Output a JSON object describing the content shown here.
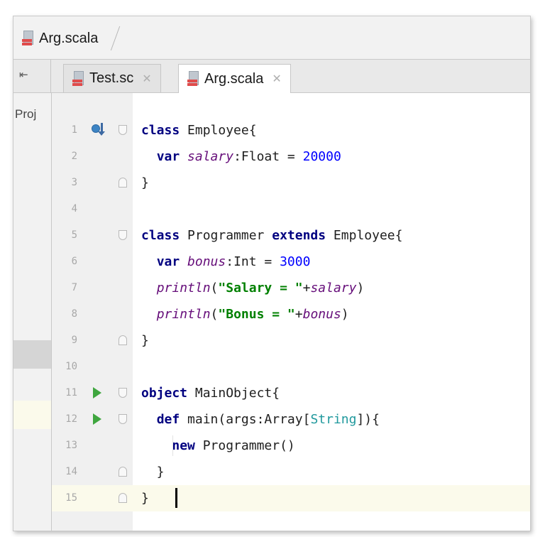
{
  "breadcrumb": {
    "file": "Arg.scala"
  },
  "tabs": [
    {
      "label": "Test.sc",
      "active": false
    },
    {
      "label": "Arg.scala",
      "active": true
    }
  ],
  "project_pane": {
    "label": "Proj"
  },
  "icons": {
    "collapse_panel": "collapse-panel-icon",
    "scala_file": "scala-file-icon",
    "run_gutter": "run-gutter-icon",
    "override_gutter": "override-gutter-icon"
  },
  "colors": {
    "keyword": "#000080",
    "field": "#660e7a",
    "number": "#0000ff",
    "string": "#008000",
    "type": "#20999d",
    "current_line": "#fbfaeb",
    "run_icon": "#3fa63f"
  },
  "editor": {
    "current_line": 15,
    "lines": [
      {
        "n": "1",
        "tokens": [
          [
            "kw",
            "class"
          ],
          [
            "id",
            " Employee{"
          ]
        ],
        "gutter": "override",
        "fold": "open"
      },
      {
        "n": "2",
        "tokens": [
          [
            "id",
            "  "
          ],
          [
            "kw",
            "var"
          ],
          [
            "id",
            " "
          ],
          [
            "var",
            "salary"
          ],
          [
            "id",
            ":Float = "
          ],
          [
            "num",
            "20000"
          ]
        ]
      },
      {
        "n": "3",
        "tokens": [
          [
            "id",
            "}"
          ]
        ],
        "fold": "close"
      },
      {
        "n": "4",
        "tokens": []
      },
      {
        "n": "5",
        "tokens": [
          [
            "kw",
            "class"
          ],
          [
            "id",
            " Programmer "
          ],
          [
            "kw",
            "extends"
          ],
          [
            "id",
            " Employee{"
          ]
        ],
        "fold": "open"
      },
      {
        "n": "6",
        "tokens": [
          [
            "id",
            "  "
          ],
          [
            "kw",
            "var"
          ],
          [
            "id",
            " "
          ],
          [
            "var",
            "bonus"
          ],
          [
            "id",
            ":Int = "
          ],
          [
            "num",
            "3000"
          ]
        ]
      },
      {
        "n": "7",
        "tokens": [
          [
            "id",
            "  "
          ],
          [
            "var",
            "println"
          ],
          [
            "id",
            "("
          ],
          [
            "str",
            "\"Salary = \""
          ],
          [
            "id",
            "+"
          ],
          [
            "var",
            "salary"
          ],
          [
            "id",
            ")"
          ]
        ]
      },
      {
        "n": "8",
        "tokens": [
          [
            "id",
            "  "
          ],
          [
            "var",
            "println"
          ],
          [
            "id",
            "("
          ],
          [
            "str",
            "\"Bonus = \""
          ],
          [
            "id",
            "+"
          ],
          [
            "var",
            "bonus"
          ],
          [
            "id",
            ")"
          ]
        ]
      },
      {
        "n": "9",
        "tokens": [
          [
            "id",
            "}"
          ]
        ],
        "fold": "close"
      },
      {
        "n": "10",
        "tokens": []
      },
      {
        "n": "11",
        "tokens": [
          [
            "kw",
            "object"
          ],
          [
            "id",
            " MainObject{"
          ]
        ],
        "gutter": "run",
        "fold": "open"
      },
      {
        "n": "12",
        "tokens": [
          [
            "id",
            "  "
          ],
          [
            "kw",
            "def"
          ],
          [
            "id",
            " main(args:Array["
          ],
          [
            "type",
            "String"
          ],
          [
            "id",
            "]){"
          ]
        ],
        "gutter": "run",
        "fold": "open"
      },
      {
        "n": "13",
        "tokens": [
          [
            "id",
            "    "
          ],
          [
            "kw",
            "new"
          ],
          [
            "id",
            " Programmer()"
          ]
        ]
      },
      {
        "n": "14",
        "tokens": [
          [
            "id",
            "  }"
          ]
        ],
        "fold": "close"
      },
      {
        "n": "15",
        "tokens": [
          [
            "id",
            "}"
          ]
        ],
        "fold": "close"
      }
    ]
  }
}
